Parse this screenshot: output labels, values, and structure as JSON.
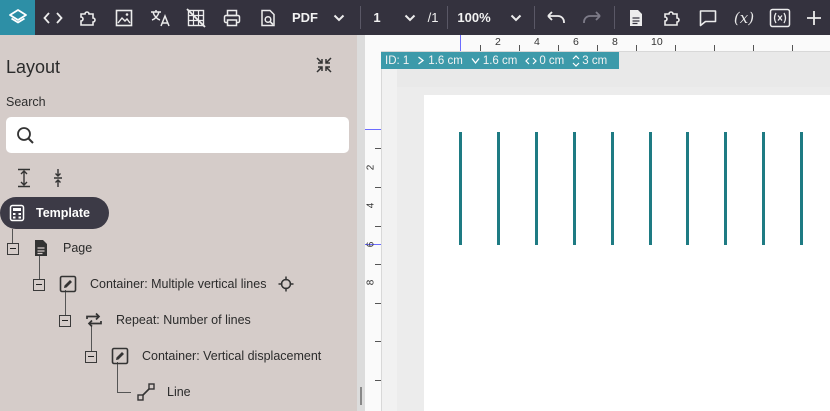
{
  "toolbar": {
    "export_format": "PDF",
    "current_page": "1",
    "total_pages": "/1",
    "zoom": "100%",
    "var_label": "(x)"
  },
  "layout_panel": {
    "title": "Layout",
    "search_label": "Search",
    "search_placeholder": "",
    "template_label": "Template",
    "tree": [
      {
        "label": "Page",
        "icon": "page-icon"
      },
      {
        "label": "Container: Multiple vertical lines",
        "icon": "edit-icon"
      },
      {
        "label": "Repeat: Number of lines",
        "icon": "repeat-icon"
      },
      {
        "label": "Container: Vertical displacement",
        "icon": "edit-icon"
      },
      {
        "label": "Line",
        "icon": "line-icon"
      }
    ]
  },
  "ruler": {
    "top_labels": [
      "2",
      "4",
      "6",
      "8",
      "10"
    ],
    "left_labels": [
      "2",
      "4",
      "6",
      "8"
    ]
  },
  "selection_info": {
    "id": "ID: 1",
    "width": "1.6 cm",
    "height": "1.6 cm",
    "x": "0 cm",
    "y": "3 cm"
  },
  "canvas": {
    "line_count": 10,
    "line_color": "#1e7b83"
  },
  "colors": {
    "toolbar_bg": "#34323e",
    "accent": "#2d8fa6",
    "panel_bg": "#d5ccc9"
  }
}
